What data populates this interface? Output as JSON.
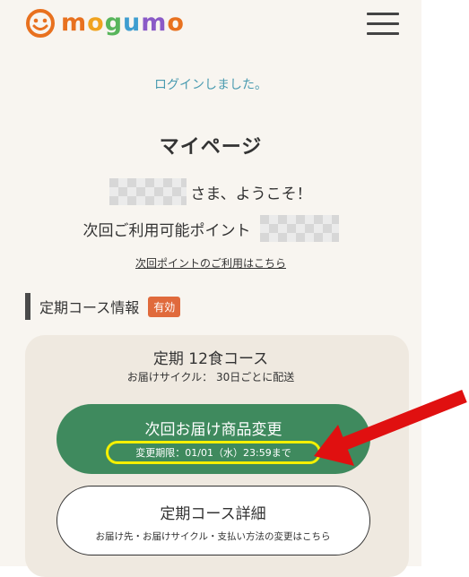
{
  "brand": {
    "name": "mogumo",
    "letters": [
      "m",
      "o",
      "g",
      "u",
      "m",
      "o"
    ],
    "letter_colors": [
      "#e8711f",
      "#f0a31f",
      "#58b55b",
      "#3f9ed0",
      "#8a5ac7",
      "#e8711f"
    ]
  },
  "header": {
    "menu_icon": "hamburger-icon"
  },
  "login_message": "ログインしました。",
  "page_title": "マイページ",
  "welcome_suffix": "さま、ようこそ！",
  "points_label": "次回ご利用可能ポイント",
  "points_link": "次回ポイントのご利用はこちら",
  "subscription": {
    "section_title": "定期コース情報",
    "status_badge": "有効",
    "course_name": "定期 12食コース",
    "delivery_cycle": "お届けサイクル： 30日ごとに配送",
    "change_button": "次回お届け商品変更",
    "change_deadline": "変更期限：01/01（水）23:59まで",
    "detail_button": "定期コース詳細",
    "detail_sub": "お届け先・お届けサイクル・支払い方法の変更はこちら"
  },
  "colors": {
    "accent_green": "#3f8a5e",
    "badge_orange": "#e06a3c",
    "link_teal": "#4a9bb0",
    "highlight_yellow": "#f4f000",
    "arrow_red": "#e01010"
  }
}
